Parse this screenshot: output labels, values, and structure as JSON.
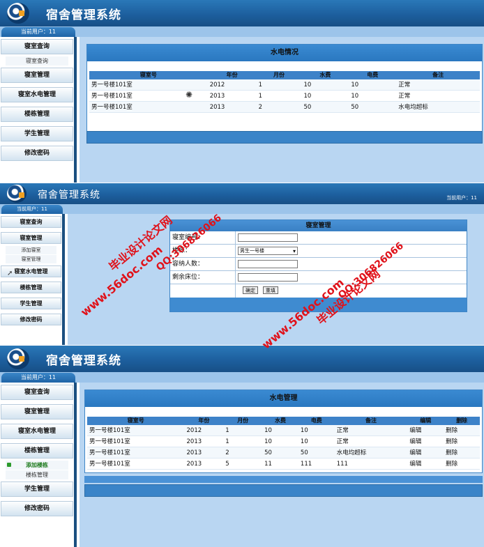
{
  "app_title": "宿舍管理系统",
  "current_user_a": "当前用户：11",
  "current_user_b": "当前用户：11",
  "panel1": {
    "sidebar": [
      "寝室查询",
      "寝室查询",
      "寝室管理",
      "寝室水电管理",
      "楼栋管理",
      "学生管理",
      "修改密码"
    ],
    "box_title": "水电情况",
    "headers": [
      "寝室号",
      "年份",
      "月份",
      "水费",
      "电费",
      "备注"
    ],
    "rows": [
      [
        "男一号楼101室",
        "2012",
        "1",
        "10",
        "10",
        "正常"
      ],
      [
        "男一号楼101室",
        "2013",
        "1",
        "10",
        "10",
        "正常"
      ],
      [
        "男一号楼101室",
        "2013",
        "2",
        "50",
        "50",
        "水电均超标"
      ]
    ]
  },
  "panel2": {
    "sidebar": [
      "寝室查询",
      "寝室管理",
      "添加寝室",
      "寝室管理",
      "寝室水电管理",
      "楼栋管理",
      "学生管理",
      "修改密码"
    ],
    "form_title": "寝室管理",
    "labels": [
      "寝室编号：",
      "楼栋：",
      "容纳人数：",
      "剩余床位："
    ],
    "building_value": "男生一号楼",
    "ok_button": "确定",
    "reset_button": "重填"
  },
  "panel3": {
    "sidebar": [
      "寝室查询",
      "寝室管理",
      "寝室水电管理",
      "楼栋管理",
      "添加楼栋",
      "楼栋管理",
      "学生管理",
      "修改密码"
    ],
    "box_title": "水电管理",
    "headers": [
      "寝室号",
      "年份",
      "月份",
      "水费",
      "电费",
      "备注",
      "编辑",
      "删除"
    ],
    "rows": [
      [
        "男一号楼101室",
        "2012",
        "1",
        "10",
        "10",
        "正常",
        "编辑",
        "删除"
      ],
      [
        "男一号楼101室",
        "2013",
        "1",
        "10",
        "10",
        "正常",
        "编辑",
        "删除"
      ],
      [
        "男一号楼101室",
        "2013",
        "2",
        "50",
        "50",
        "水电均超标",
        "编辑",
        "删除"
      ],
      [
        "男一号楼101室",
        "2013",
        "5",
        "11",
        "111",
        "111",
        "编辑",
        "删除"
      ]
    ]
  },
  "watermark": {
    "site": "www.56doc.com",
    "name": "毕业设计论文网",
    "qq": "QQ:306826066",
    "color": "#e0121a"
  }
}
